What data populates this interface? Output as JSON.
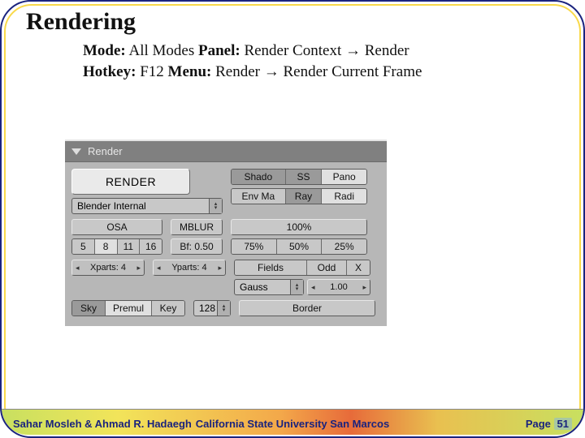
{
  "title": "Rendering",
  "meta": {
    "mode_label": "Mode:",
    "mode": "All Modes",
    "panel_label": "Panel:",
    "panel": "Render Context → Render",
    "hotkey_label": "Hotkey:",
    "hotkey": "F12",
    "menu_label": "Menu:",
    "menu": "Render → Render Current Frame"
  },
  "panel": {
    "header": "Render",
    "render_button": "RENDER",
    "engine": "Blender Internal",
    "opts_row1": [
      "Shado",
      "SS",
      "Pano"
    ],
    "opts_row2": [
      "Env Ma",
      "Ray",
      "Radi"
    ],
    "osa_label": "OSA",
    "osa_values": [
      "5",
      "8",
      "11",
      "16"
    ],
    "mblur_label": "MBLUR",
    "mblur_bf": "Bf: 0.50",
    "size_main": "100%",
    "size_values": [
      "75%",
      "50%",
      "25%"
    ],
    "xparts": "Xparts: 4",
    "yparts": "Yparts: 4",
    "fields": "Fields",
    "odd": "Odd",
    "x": "X",
    "gauss": "Gauss",
    "gauss_val": "1.00",
    "sky_row": [
      "Sky",
      "Premul",
      "Key"
    ],
    "val128": "128",
    "border": "Border"
  },
  "footer": {
    "left": "Sahar Mosleh & Ahmad R. Hadaegh",
    "center": "California State University San Marcos",
    "page_label": "Page",
    "page_num": "51"
  }
}
